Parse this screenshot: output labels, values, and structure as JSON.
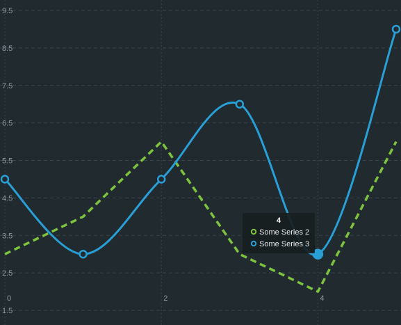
{
  "chart_data": {
    "type": "line",
    "title": "",
    "xlabel": "",
    "ylabel": "",
    "xlim": [
      0,
      5
    ],
    "ylim": [
      1.5,
      9.5
    ],
    "x_ticks": [
      0,
      2,
      4
    ],
    "y_ticks": [
      1.5,
      2.5,
      3.5,
      4.5,
      5.5,
      6.5,
      7.5,
      8.5,
      9.5
    ],
    "x_tick_labels": [
      "0",
      "2",
      "4"
    ],
    "y_tick_labels": [
      "1.5",
      "2.5",
      "3.5",
      "4.5",
      "5.5",
      "6.5",
      "7.5",
      "8.5",
      "9.5"
    ],
    "grid": true,
    "series": [
      {
        "name": "Some Series 2",
        "style": "dashed",
        "color": "#7ec240",
        "x": [
          0,
          1,
          2,
          3,
          4,
          5
        ],
        "values": [
          3,
          4,
          6,
          3,
          2,
          6
        ]
      },
      {
        "name": "Some Series 3",
        "style": "smooth-markers",
        "color": "#2a9fd6",
        "x": [
          0,
          1,
          2,
          3,
          4,
          5
        ],
        "values": [
          5,
          3,
          5,
          7,
          3,
          9
        ]
      }
    ],
    "tooltip": {
      "title": "4",
      "entries": [
        "Some Series 2",
        "Some Series 3"
      ],
      "highlight_x": 4
    }
  },
  "colors": {
    "background": "#202a2f",
    "grid": "#3a464c",
    "tick_label": "#8f9aa2",
    "tooltip_bg": "#181e21"
  }
}
